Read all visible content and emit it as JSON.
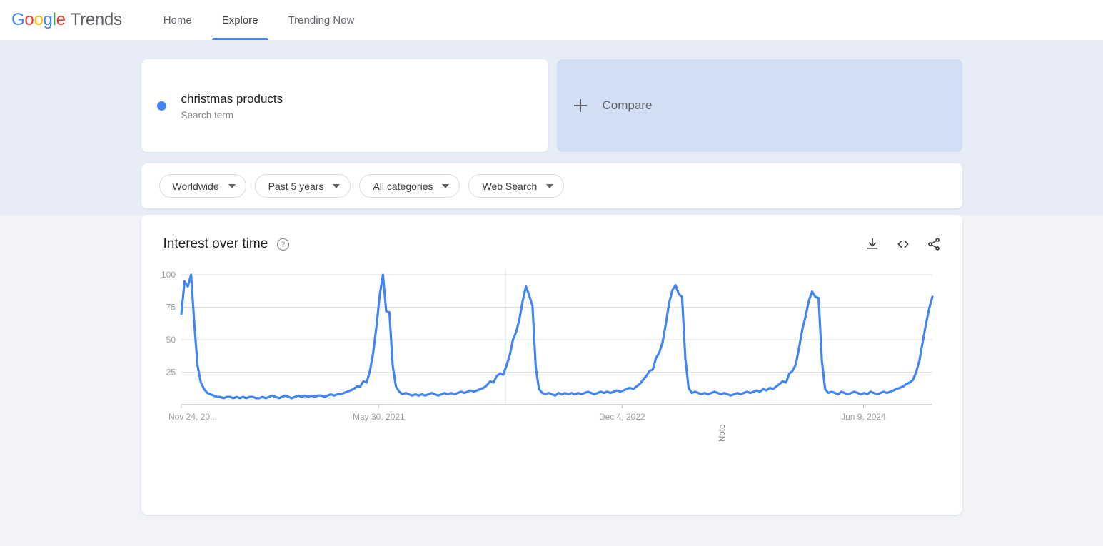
{
  "nav": {
    "brand_google": [
      "G",
      "o",
      "o",
      "g",
      "l",
      "e"
    ],
    "brand_suffix": "Trends",
    "links": [
      {
        "label": "Home",
        "active": false
      },
      {
        "label": "Explore",
        "active": true
      },
      {
        "label": "Trending Now",
        "active": false
      }
    ]
  },
  "query": {
    "term": "christmas products",
    "term_type": "Search term",
    "dot_color": "#4285F4",
    "compare_label": "Compare",
    "compare_icon": "plus-icon"
  },
  "filters": [
    {
      "label": "Worldwide",
      "icon": "chevron-down-icon"
    },
    {
      "label": "Past 5 years",
      "icon": "chevron-down-icon"
    },
    {
      "label": "All categories",
      "icon": "chevron-down-icon"
    },
    {
      "label": "Web Search",
      "icon": "chevron-down-icon"
    }
  ],
  "chart_panel": {
    "title": "Interest over time",
    "help_icon": "question-mark-icon",
    "help_glyph": "?",
    "actions": [
      {
        "name": "download-icon",
        "tooltip": "Download"
      },
      {
        "name": "embed-code-icon",
        "tooltip": "Embed"
      },
      {
        "name": "share-icon",
        "tooltip": "Share"
      }
    ],
    "note_label": "Note"
  },
  "chart_data": {
    "type": "line",
    "title": "Interest over time",
    "xlabel": "",
    "ylabel": "",
    "ylim": [
      0,
      100
    ],
    "yticks": [
      100,
      75,
      50,
      25
    ],
    "grid": true,
    "legend": false,
    "line_color": "#4285F4",
    "xticks": [
      "Nov 24, 20...",
      "May 30, 2021",
      "Dec 4, 2022",
      "Jun 9, 2024"
    ],
    "xtick_positions": [
      0,
      0.2627,
      0.5868,
      0.9082
    ],
    "annotations": [
      {
        "label": "Note",
        "x_fraction": 0.4315
      }
    ],
    "series": [
      {
        "name": "christmas products",
        "values": [
          70,
          95,
          91,
          100,
          62,
          30,
          17,
          12,
          9,
          8,
          7,
          6,
          6,
          5,
          6,
          6,
          5,
          6,
          5,
          6,
          5,
          6,
          6,
          5,
          5,
          6,
          5,
          6,
          7,
          6,
          5,
          6,
          7,
          6,
          5,
          6,
          7,
          6,
          7,
          6,
          7,
          6,
          7,
          7,
          6,
          7,
          8,
          7,
          8,
          8,
          9,
          10,
          11,
          12,
          14,
          14,
          18,
          17,
          26,
          40,
          60,
          84,
          100,
          72,
          71,
          30,
          14,
          10,
          8,
          9,
          8,
          7,
          8,
          7,
          8,
          7,
          8,
          9,
          8,
          7,
          8,
          9,
          8,
          9,
          8,
          9,
          10,
          9,
          10,
          11,
          10,
          11,
          12,
          13,
          15,
          18,
          17,
          22,
          24,
          23,
          30,
          38,
          50,
          56,
          66,
          80,
          91,
          84,
          76,
          29,
          12,
          9,
          8,
          9,
          8,
          7,
          9,
          8,
          9,
          8,
          9,
          8,
          9,
          8,
          9,
          10,
          9,
          8,
          9,
          10,
          9,
          10,
          9,
          10,
          11,
          10,
          11,
          12,
          13,
          12,
          14,
          16,
          19,
          22,
          26,
          27,
          36,
          40,
          48,
          62,
          78,
          88,
          92,
          85,
          83,
          36,
          13,
          9,
          10,
          9,
          8,
          9,
          8,
          9,
          10,
          9,
          8,
          9,
          8,
          7,
          8,
          9,
          8,
          9,
          10,
          9,
          10,
          11,
          10,
          12,
          11,
          13,
          12,
          14,
          16,
          18,
          17,
          24,
          26,
          31,
          44,
          58,
          68,
          80,
          87,
          83,
          82,
          34,
          12,
          9,
          10,
          9,
          8,
          10,
          9,
          8,
          9,
          10,
          9,
          8,
          9,
          8,
          10,
          9,
          8,
          9,
          10,
          9,
          10,
          11,
          12,
          13,
          14,
          16,
          17,
          19,
          25,
          34,
          48,
          62,
          74,
          83
        ]
      }
    ]
  }
}
